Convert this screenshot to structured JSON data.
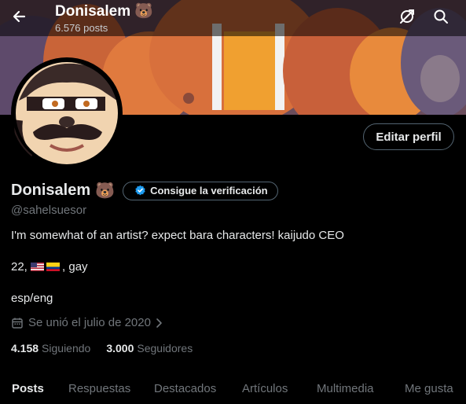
{
  "header": {
    "back_icon": "arrow-left-icon",
    "name": "Donisalem",
    "emoji": "🐻",
    "posts_count": "6.576 posts",
    "actions": [
      "swap-icon",
      "search-icon"
    ]
  },
  "profile": {
    "display_name": "Donisalem",
    "emoji": "🐻",
    "verify_label": "Consigue la verificación",
    "handle": "@sahelsuesor",
    "edit_label": "Editar perfil",
    "bio_line1": "I'm somewhat of an artist? expect bara characters! kaijudo CEO",
    "bio_line2_prefix": "22, ",
    "bio_line2_suffix": ", gay",
    "bio_line3": "esp/eng",
    "joined": "Se unió el julio de 2020"
  },
  "stats": {
    "following_count": "4.158",
    "following_label": "Siguiendo",
    "followers_count": "3.000",
    "followers_label": "Seguidores"
  },
  "tabs": [
    {
      "label": "Posts",
      "active": true
    },
    {
      "label": "Respuestas",
      "active": false
    },
    {
      "label": "Destacados",
      "active": false
    },
    {
      "label": "Artículos",
      "active": false
    },
    {
      "label": "Multimedia",
      "active": false
    },
    {
      "label": "Me gusta",
      "active": false
    }
  ],
  "colors": {
    "accent": "#1d9bf0",
    "background": "#000000",
    "secondary_text": "#71767b"
  }
}
